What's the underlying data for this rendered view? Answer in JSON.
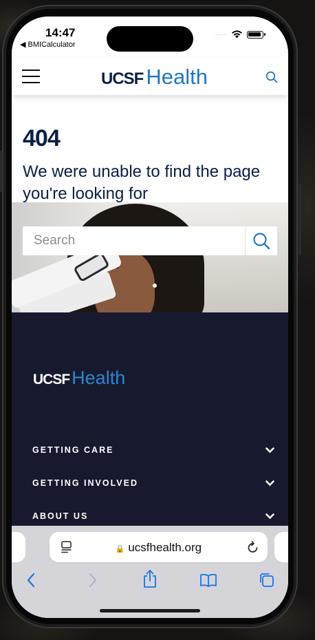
{
  "status_bar": {
    "time": "14:47",
    "back_app": "◀ BMICalculator",
    "signal_dots": "····",
    "icons": [
      "wifi-icon",
      "battery-icon"
    ]
  },
  "header": {
    "menu_icon": "hamburger-icon",
    "logo_ucsf": "UCSF",
    "logo_health": "Health",
    "search_icon": "search-icon"
  },
  "main": {
    "error_code": "404",
    "error_message": "We were unable to find the page you're looking for",
    "search": {
      "placeholder": "Search",
      "value": "",
      "button_icon": "search-icon"
    }
  },
  "footer": {
    "logo_ucsf": "UCSF",
    "logo_health": "Health",
    "nav": [
      {
        "label": "GETTING CARE",
        "icon": "chevron-down-icon"
      },
      {
        "label": "GETTING INVOLVED",
        "icon": "chevron-down-icon"
      },
      {
        "label": "ABOUT US",
        "icon": "chevron-down-icon"
      }
    ]
  },
  "browser": {
    "url": "ucsfhealth.org",
    "lock_icon": "🔒",
    "toolbar": [
      "back-icon",
      "forward-icon",
      "share-icon",
      "bookmarks-icon",
      "tabs-icon"
    ],
    "colors": {
      "accent": "#1a73e8",
      "disabled": "#a9b5c8"
    }
  },
  "colors": {
    "brand_navy": "#0a1f44",
    "brand_blue": "#1f78c2",
    "footer_bg": "#171a2e"
  }
}
